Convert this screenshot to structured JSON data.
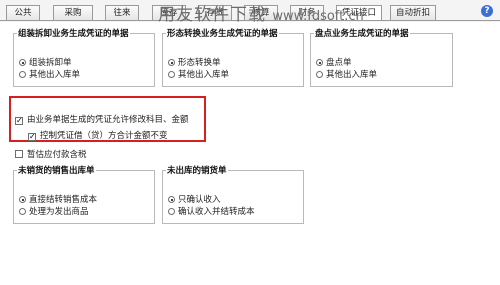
{
  "tabs": [
    "公共",
    "采购",
    "往来",
    "库存",
    "存货",
    "核算",
    "财务",
    "凭证接口",
    "自动折扣"
  ],
  "help_glyph": "?",
  "watermark": {
    "zh": "用友软件下载",
    "en": "www.fdsoft.cn"
  },
  "groups": {
    "assembly": {
      "title": "组装拆卸业务生成凭证的单据",
      "options": [
        "组装拆卸单",
        "其他出入库单"
      ],
      "selected": 0
    },
    "transform": {
      "title": "形态转换业务生成凭证的单据",
      "options": [
        "形态转换单",
        "其他出入库单"
      ],
      "selected": 0
    },
    "inventory_count": {
      "title": "盘点业务生成凭证的单据",
      "options": [
        "盘点单",
        "其他出入库单"
      ],
      "selected": 0
    },
    "unsold_outbound": {
      "title": "未销货的销售出库单",
      "options": [
        "直接结转销售成本",
        "处理为发出商品"
      ],
      "selected": 0
    },
    "unshipped_sales": {
      "title": "未出库的销货单",
      "options": [
        "只确认收入",
        "确认收入并结转成本"
      ],
      "selected": 0
    }
  },
  "checkboxes": {
    "allow_modify": {
      "label": "由业务单据生成的凭证允许修改科目、金额",
      "checked": true
    },
    "control_total": {
      "label": "控制凭证借（贷）方合计金额不变",
      "checked": true
    },
    "shipping_tax": {
      "label": "暂估应付款含税",
      "checked": false
    }
  },
  "colors": {
    "highlight_border": "#d42020",
    "help_button": "#3b6fd6"
  }
}
